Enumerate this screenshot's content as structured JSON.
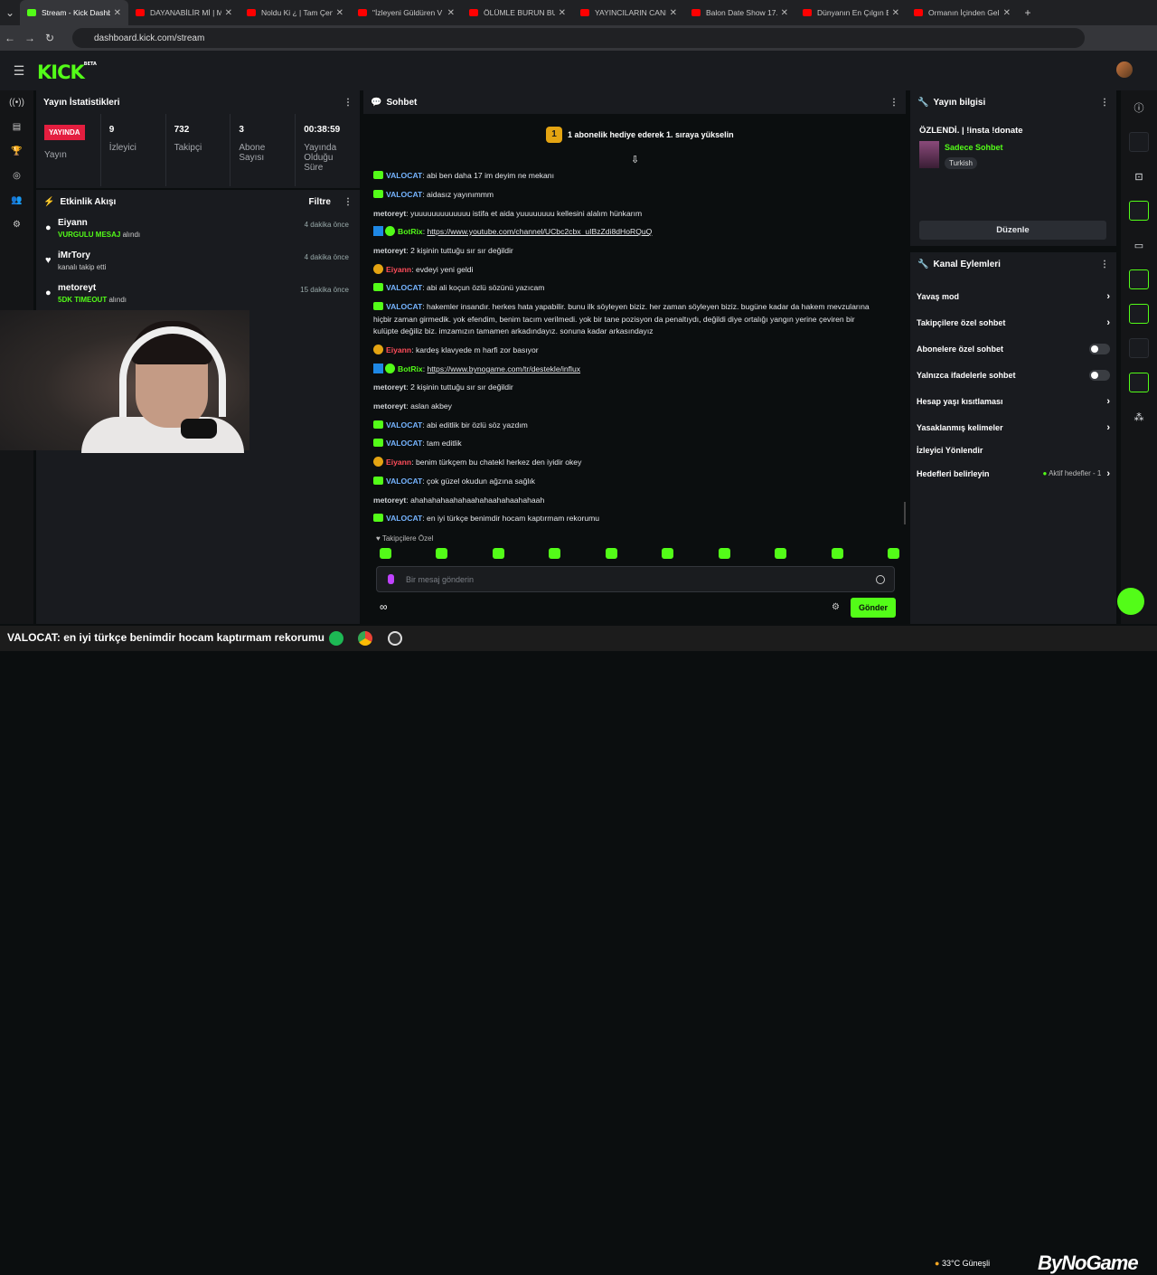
{
  "browser": {
    "tabs": [
      "Stream - Kick Dashb",
      "DAYANABİLİR Mİ | M",
      "Noldu Ki ¿ | Tam Çen",
      "\"İzleyeni Güldüren V",
      "ÖLÜMLE BURUN BUR",
      "YAYINCILARIN CANL",
      "Balon Date Show 17.",
      "Dünyanın En Çılgın B",
      "Ormanın İçinden Gel"
    ],
    "url": "dashboard.kick.com/stream"
  },
  "brand": {
    "logo": "KICK",
    "beta": "BETA"
  },
  "stats_panel": {
    "title": "Yayın İstatistikleri",
    "live_label": "YAYINDA",
    "live_caption": "Yayın",
    "items": [
      {
        "value": "9",
        "label": "İzleyici"
      },
      {
        "value": "732",
        "label": "Takipçi"
      },
      {
        "value": "3",
        "label": "Abone Sayısı"
      },
      {
        "value": "00:38:59",
        "label": "Yayında Olduğu Süre"
      }
    ]
  },
  "activity": {
    "title": "Etkinlik Akışı",
    "filter": "Filtre",
    "items": [
      {
        "name": "Eiyann",
        "highlight": "VURGULU MESAJ",
        "rest": " alındı",
        "time": "4 dakika önce"
      },
      {
        "name": "iMrTory",
        "highlight": "",
        "rest": "kanalı takip etti",
        "time": "4 dakika önce"
      },
      {
        "name": "metoreyt",
        "highlight": "5DK TIMEOUT",
        "rest": " alındı",
        "time": "15 dakika önce"
      }
    ]
  },
  "chat": {
    "title": "Sohbet",
    "pinned_rank": "1",
    "pinned_text": "1 abonelik hediye ederek 1. sıraya yükselin",
    "followers_only": "Takipçilere Özel",
    "placeholder": "Bir mesaj gönderin",
    "send": "Gönder",
    "messages": [
      {
        "user": "VALOCAT",
        "text": ": abi ben daha 17 im deyim ne mekanı"
      },
      {
        "user": "VALOCAT",
        "text": ": aidasız yayınımmm"
      },
      {
        "user": "metoreyt",
        "text": ": yuuuuuuuuuuuuu istifa et aida yuuuuuuuu kellesini alalım hünkarım"
      },
      {
        "user": "BotRix",
        "text": ": ",
        "link": "https://www.youtube.com/channel/UCbc2cbx_uIBzZdi8dHoRQuQ"
      },
      {
        "user": "metoreyt",
        "text": ": 2 kişinin tuttuğu sır sır değildir"
      },
      {
        "user": "Eiyann",
        "text": ": evdeyi yeni geldi"
      },
      {
        "user": "VALOCAT",
        "text": ": abi ali koçun özlü sözünü yazıcam"
      },
      {
        "user": "VALOCAT",
        "text": ": hakemler insandır. herkes hata yapabilir. bunu ilk söyleyen biziz. her zaman söyleyen biziz. bugüne kadar da hakem mevzularına hiçbir zaman girmedik. yok efendim, benim tacım verilmedi. yok bir tane pozisyon da penaltıydı, değildi diye ortalığı yangın yerine çeviren bir kulüpte değiliz biz. imzamızın tamamen arkadındayız. sonuna kadar arkasındayız"
      },
      {
        "user": "Eiyann",
        "text": ": kardeş klavyede m harfi zor basıyor"
      },
      {
        "user": "BotRix",
        "text": ": ",
        "link": "https://www.bynogame.com/tr/destekle/influx"
      },
      {
        "user": "metoreyt",
        "text": ": 2 kişinin tuttuğu sır sır değildir"
      },
      {
        "user": "metoreyt",
        "text": ": aslan akbey"
      },
      {
        "user": "VALOCAT",
        "text": ": abi editlik bir özlü söz yazdım"
      },
      {
        "user": "VALOCAT",
        "text": ": tam editlik"
      },
      {
        "user": "Eiyann",
        "text": ": benim türkçem bu chatekl herkez den iyidir okey"
      },
      {
        "user": "VALOCAT",
        "text": ": çok güzel okudun ağzına sağlık"
      },
      {
        "user": "metoreyt",
        "text": ": ahahahahaahahaahahaahahaahahaah"
      },
      {
        "user": "VALOCAT",
        "text": ": en iyi türkçe benimdir hocam kaptırmam rekorumu"
      }
    ]
  },
  "stream_info": {
    "title": "Yayın bilgisi",
    "stream_title": "ÖZLENDİ. | !insta !donate",
    "category": "Sadece Sohbet",
    "language": "Turkish",
    "edit": "Düzenle"
  },
  "channel_actions": {
    "title": "Kanal Eylemleri",
    "items": [
      "Yavaş mod",
      "Takipçilere özel sohbet",
      "Abonelere özel sohbet",
      "Yalnızca ifadelerle sohbet",
      "Hesap yaşı kısıtlaması",
      "Yasaklanmış kelimeler",
      "İzleyici Yönlendir",
      "Hedefleri belirleyin"
    ],
    "goals_status": "Aktif hedefler - 1"
  },
  "taskbar": {
    "ticker": "VALOCAT: en iyi türkçe benimdir hocam kaptırmam rekorumu",
    "temp": "33°C",
    "weather": "Güneşli",
    "watermark": "ByNoGame"
  }
}
